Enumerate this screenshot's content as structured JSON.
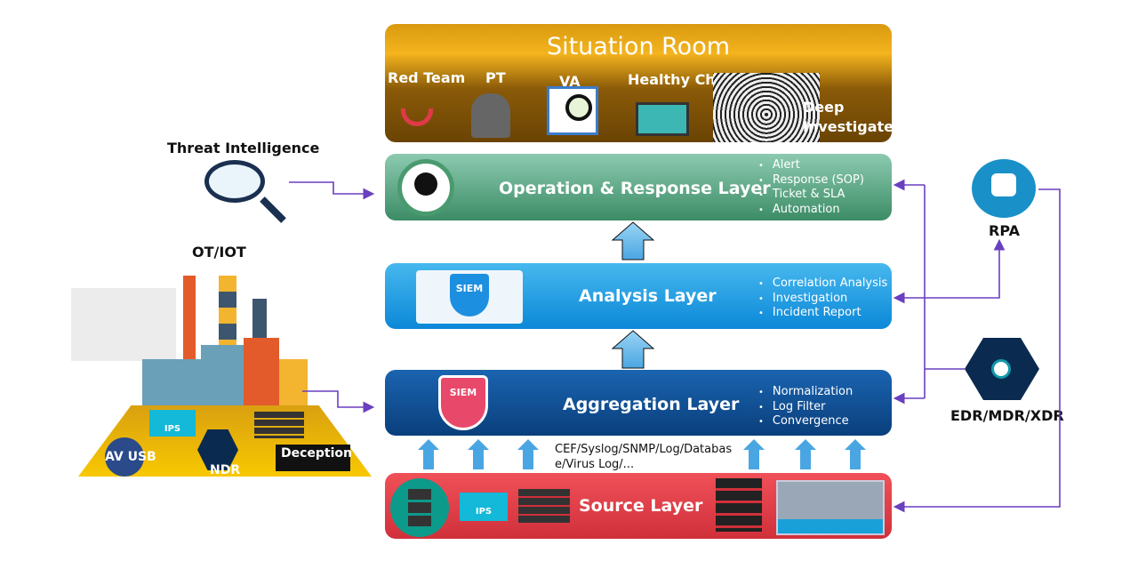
{
  "situation_room": {
    "title": "Situation Room",
    "items": [
      "Red Team",
      "PT",
      "VA",
      "Healthy Check",
      "Deep Investigate"
    ]
  },
  "layers": {
    "operation": {
      "title": "Operation & Response Layer",
      "bullets": [
        "Alert",
        "Response (SOP)",
        "Ticket & SLA",
        "Automation"
      ],
      "color": "#4e9e78"
    },
    "analysis": {
      "title": "Analysis Layer",
      "bullets": [
        "Correlation Analysis",
        "Investigation",
        "Incident Report"
      ],
      "badge": "SIEM",
      "color": "#1c9be0"
    },
    "aggregation": {
      "title": "Aggregation Layer",
      "bullets": [
        "Normalization",
        "Log Filter",
        "Convergence"
      ],
      "badge": "SIEM",
      "color": "#0e4d8f"
    },
    "source": {
      "title": "Source Layer",
      "badge": "IPS",
      "color": "#e23b44"
    }
  },
  "log_sources": "CEF/Syslog/SNMP/Log/Database/Virus Log/...",
  "left": {
    "threat_intel": "Threat Intelligence",
    "ot_iot": "OT/IOT",
    "ips": "IPS",
    "av_usb": "AV USB",
    "ndr": "NDR",
    "deception": "Deception"
  },
  "right": {
    "rpa": "RPA",
    "edr": "EDR/MDR/XDR"
  },
  "connector_color": "#6a3fc0"
}
